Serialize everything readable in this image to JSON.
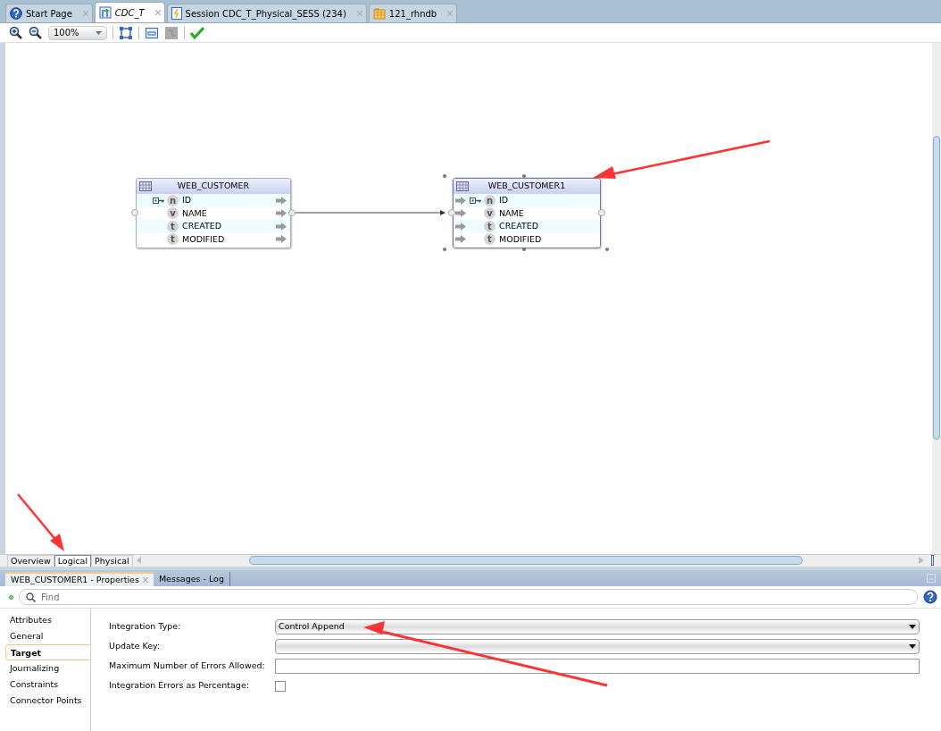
{
  "tabs": [
    {
      "label": "Start Page",
      "kind": "help",
      "selected": false
    },
    {
      "label": "CDC_T",
      "kind": "mapping",
      "selected": true
    },
    {
      "label": "Session CDC_T_Physical_SESS (234)",
      "kind": "session",
      "selected": false
    },
    {
      "label": "121_rhndb",
      "kind": "datastore",
      "selected": false
    }
  ],
  "toolbar": {
    "zoom": "100%"
  },
  "diagram": {
    "nodes": [
      {
        "title": "WEB_CUSTOMER",
        "kind": "source",
        "selected": false,
        "columns": [
          {
            "name": "ID",
            "type": "n",
            "key": true
          },
          {
            "name": "NAME",
            "type": "v",
            "key": false
          },
          {
            "name": "CREATED",
            "type": "t",
            "key": false
          },
          {
            "name": "MODIFIED",
            "type": "t",
            "key": false
          }
        ]
      },
      {
        "title": "WEB_CUSTOMER1",
        "kind": "target",
        "selected": true,
        "columns": [
          {
            "name": "ID",
            "type": "n",
            "key": true
          },
          {
            "name": "NAME",
            "type": "v",
            "key": false
          },
          {
            "name": "CREATED",
            "type": "t",
            "key": false
          },
          {
            "name": "MODIFIED",
            "type": "t",
            "key": false
          }
        ]
      }
    ]
  },
  "view_tabs": [
    {
      "label": "Overview",
      "selected": false
    },
    {
      "label": "Logical",
      "selected": true
    },
    {
      "label": "Physical",
      "selected": false
    }
  ],
  "panel_tabs": [
    {
      "label": "WEB_CUSTOMER1 - Properties",
      "selected": true
    },
    {
      "label": "Messages - Log",
      "selected": false
    }
  ],
  "find": {
    "placeholder": "Find"
  },
  "sections": [
    {
      "label": "Attributes",
      "selected": false
    },
    {
      "label": "General",
      "selected": false
    },
    {
      "label": "Target",
      "selected": true
    },
    {
      "label": "Journalizing",
      "selected": false
    },
    {
      "label": "Constraints",
      "selected": false
    },
    {
      "label": "Connector Points",
      "selected": false
    }
  ],
  "fields": [
    {
      "label": "Integration Type:",
      "kind": "dropdown",
      "value": "Control Append"
    },
    {
      "label": "Update Key:",
      "kind": "dropdown"
    },
    {
      "label": "Maximum Number of Errors Allowed:",
      "kind": "text"
    },
    {
      "label": "Integration Errors as Percentage:",
      "kind": "checkbox",
      "checked": false
    }
  ]
}
